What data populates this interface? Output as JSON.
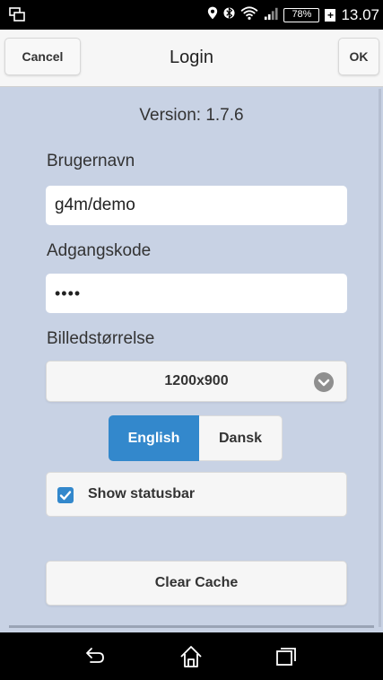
{
  "statusbar": {
    "battery_percent": "78%",
    "battery_level": 0.78,
    "clock": "13.07",
    "icons": [
      "screen-mirror-icon",
      "location-icon",
      "bluetooth-icon",
      "wifi-icon",
      "signal-icon",
      "battery-icon",
      "charging-icon"
    ]
  },
  "header": {
    "cancel_label": "Cancel",
    "title": "Login",
    "ok_label": "OK"
  },
  "form": {
    "version": "Version: 1.7.6",
    "username_label": "Brugernavn",
    "username_value": "g4m/demo",
    "password_label": "Adgangskode",
    "password_value": "••••",
    "image_size_label": "Billedstørrelse",
    "image_size_value": "1200x900",
    "languages": [
      "English",
      "Dansk"
    ],
    "selected_language": "English",
    "show_statusbar_label": "Show statusbar",
    "show_statusbar_checked": true,
    "clear_cache_label": "Clear Cache"
  },
  "colors": {
    "accent": "#3388cc",
    "content_bg": "#c8d2e4"
  },
  "navbar": {
    "icons": [
      "back-icon",
      "home-icon",
      "recent-apps-icon"
    ]
  }
}
